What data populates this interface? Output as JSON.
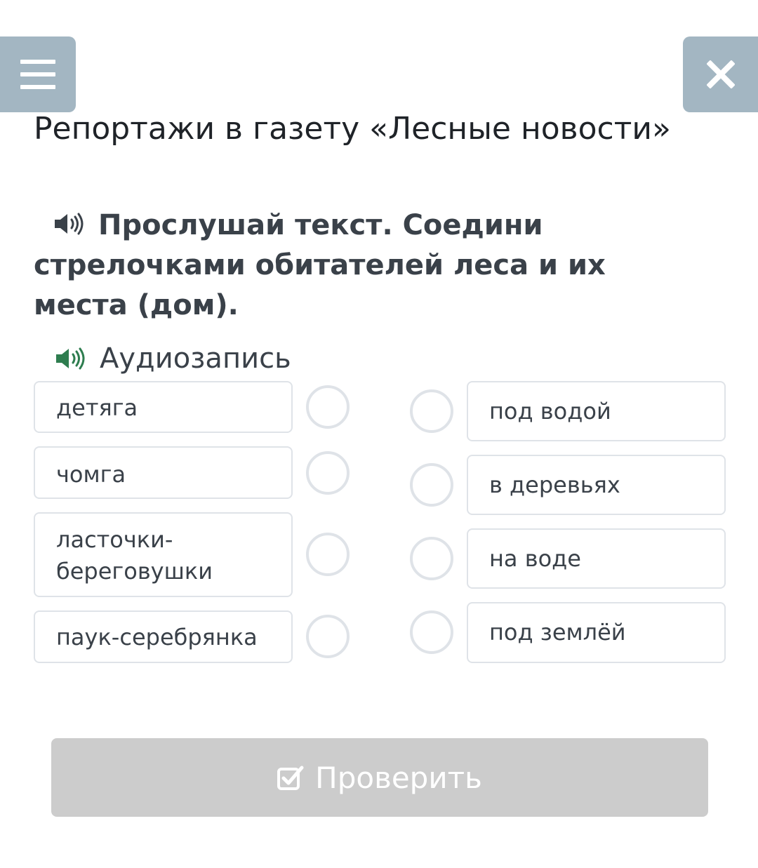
{
  "header": {
    "menu_icon": "hamburger-menu-icon",
    "close_icon": "close-x-icon",
    "title": "Репортажи в газету «Лесные новости»"
  },
  "task": {
    "icon": "speaker-icon",
    "text": "Прослушай текст. Соедини стрелочками обитателей леса и их места (дом)."
  },
  "audio": {
    "icon": "speaker-icon",
    "label": "Аудиозапись",
    "icon_color": "#2e7d4f"
  },
  "left_items": [
    "детяга",
    "чомга",
    "ласточки-береговушки",
    "паук-серебрянка"
  ],
  "right_items": [
    "под водой",
    "в деревьях",
    "на воде",
    "под землёй"
  ],
  "check_button": {
    "icon": "checkbox-check-icon",
    "label": "Проверить"
  },
  "colors": {
    "corner_button_bg": "#a3b6c2",
    "card_border": "#dfe3e8",
    "check_button_bg": "#cccccc"
  }
}
